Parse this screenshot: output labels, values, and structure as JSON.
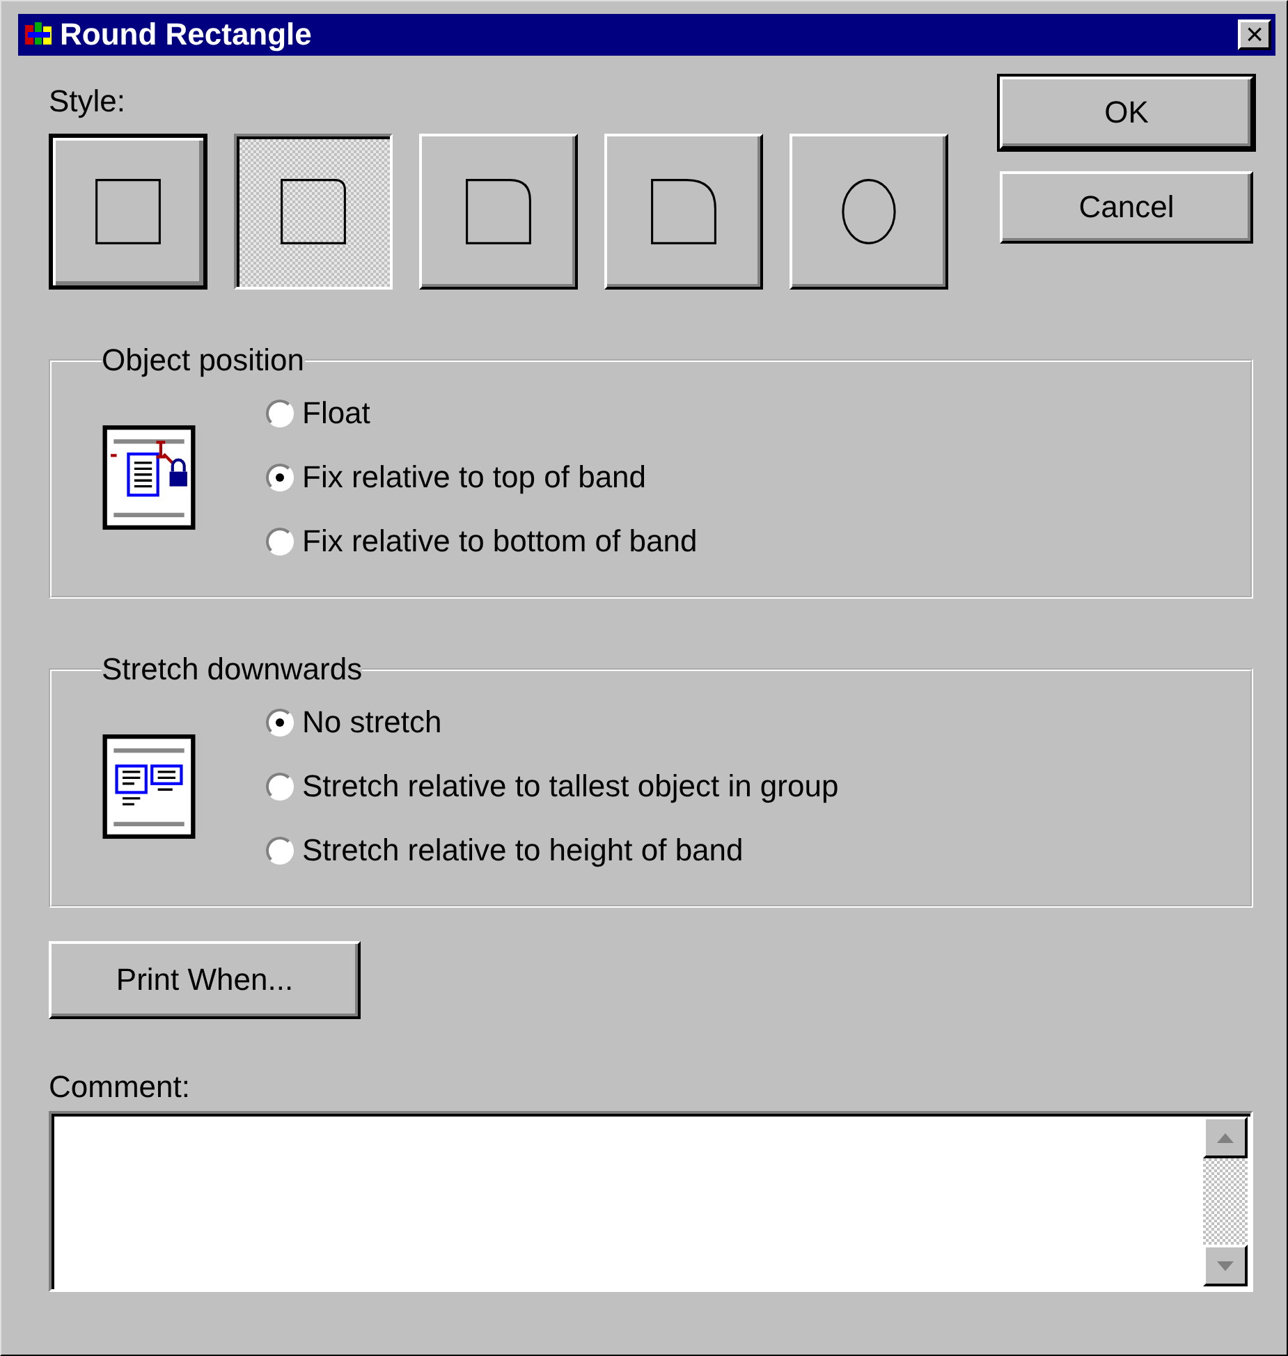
{
  "window": {
    "title": "Round Rectangle",
    "close": "×"
  },
  "style": {
    "label": "Style:",
    "options": [
      {
        "kind": "square",
        "selected": false,
        "focused": true
      },
      {
        "kind": "roundsmall",
        "selected": true,
        "focused": false
      },
      {
        "kind": "roundmedium",
        "selected": false,
        "focused": false
      },
      {
        "kind": "roundlarge",
        "selected": false,
        "focused": false
      },
      {
        "kind": "ellipse",
        "selected": false,
        "focused": false
      }
    ]
  },
  "buttons": [
    {
      "label": "OK",
      "default": true
    },
    {
      "label": "Cancel",
      "default": false
    }
  ],
  "groups": [
    {
      "title": "Object position",
      "kind": "position",
      "options": [
        {
          "label": "Float",
          "selected": false
        },
        {
          "label": "Fix relative to top of band",
          "selected": true
        },
        {
          "label": "Fix relative to bottom of band",
          "selected": false
        }
      ]
    },
    {
      "title": "Stretch downwards",
      "kind": "stretch",
      "options": [
        {
          "label": "No stretch",
          "selected": true
        },
        {
          "label": "Stretch relative to tallest object in group",
          "selected": false
        },
        {
          "label": "Stretch relative to height of band",
          "selected": false
        }
      ]
    }
  ],
  "print_when": {
    "label": "Print When..."
  },
  "comment": {
    "label": "Comment:"
  }
}
